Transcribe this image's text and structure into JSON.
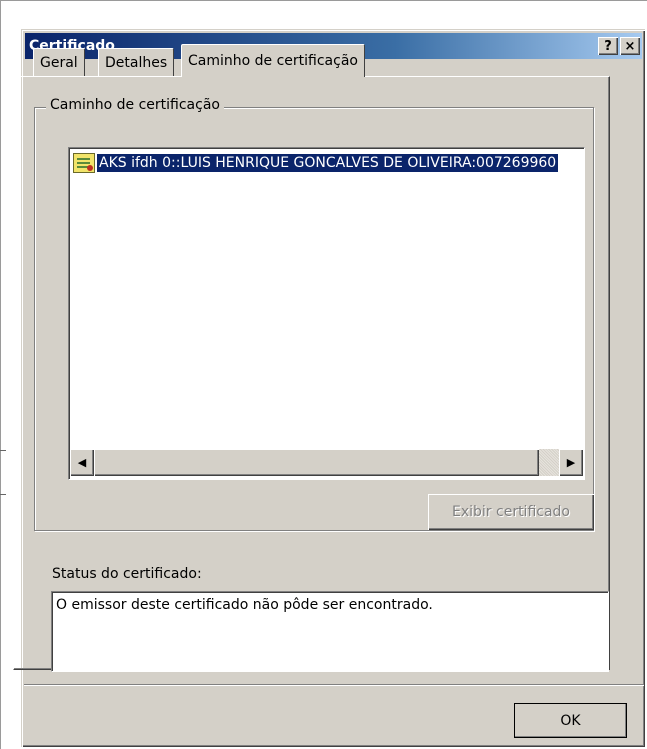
{
  "window": {
    "title": "Certificado",
    "help_button": "?",
    "close_button": "×"
  },
  "tabs": [
    {
      "label": "Geral",
      "active": false
    },
    {
      "label": "Detalhes",
      "active": false
    },
    {
      "label": "Caminho de certificação",
      "active": true
    }
  ],
  "path_group": {
    "legend": "Caminho de certificação",
    "items": [
      {
        "label": "AKS ifdh 0::LUIS HENRIQUE GONCALVES DE OLIVEIRA:007269960",
        "icon": "certificate-warning-icon",
        "selected": true
      }
    ],
    "view_button": "Exibir certificado",
    "view_button_enabled": false
  },
  "status": {
    "label": "Status do certificado:",
    "text": "O emissor deste certificado não pôde ser encontrado."
  },
  "footer": {
    "ok_label": "OK"
  },
  "colors": {
    "title_bar": "#0a246a",
    "dialog_bg": "#d4d0c8",
    "selection": "#0a246a"
  }
}
